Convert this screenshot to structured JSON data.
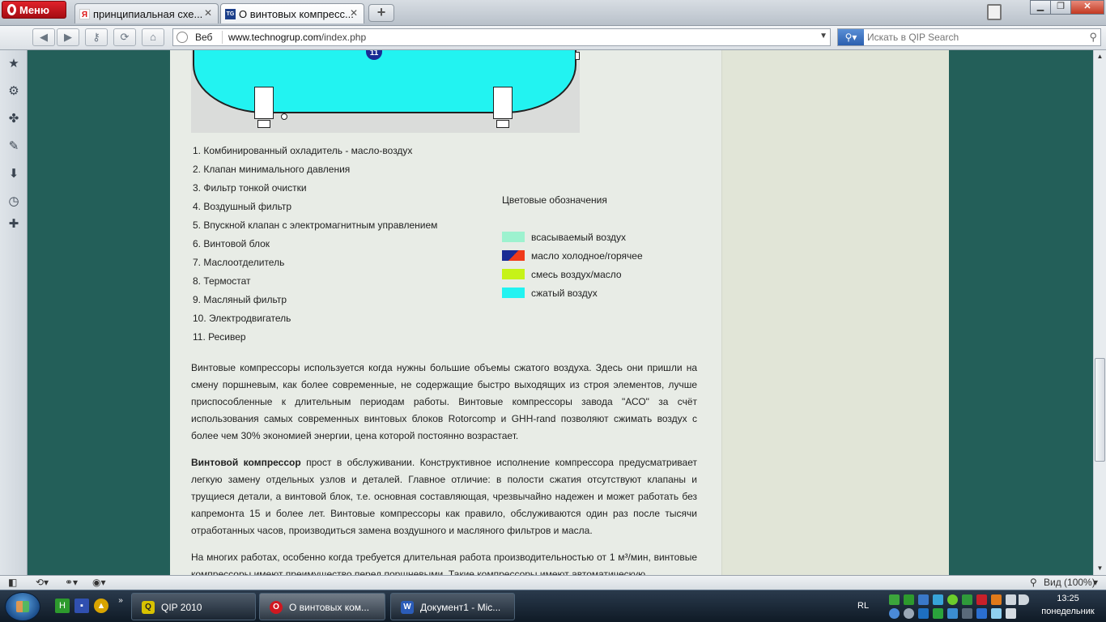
{
  "browser": {
    "menu_label": "Меню",
    "tabs": [
      {
        "label": "принципиальная схе...",
        "favicon": "Я",
        "active": false
      },
      {
        "label": "О винтовых компресс...",
        "favicon": "TG",
        "active": true
      }
    ],
    "new_tab_label": "+",
    "address": {
      "mode_label": "Веб",
      "domain": "www.technogrup.com",
      "path": "/index.php"
    },
    "search_placeholder": "Искать в QIP Search",
    "zoom_label": "Вид (100%)"
  },
  "page": {
    "parts_list": [
      "1. Комбинированный охладитель - масло-воздух",
      "2. Клапан минимального давления",
      "3. Фильтр тонкой очистки",
      "4. Воздушный фильтр",
      "5. Впускной клапан с электромагнитным управлением",
      "6. Винтовой блок",
      "7. Маслоотделитель",
      "8. Термостат",
      "9. Масляный фильтр",
      "10. Электродвигатель",
      "11. Ресивер"
    ],
    "diagram_marker": "11",
    "legend": {
      "title": "Цветовые обозначения",
      "items": [
        {
          "label": "всасываемый воздух",
          "color": "#9df2cf"
        },
        {
          "label": "масло холодное/горячее",
          "color": "#1a2b94",
          "color2": "#f03a1a"
        },
        {
          "label": "смесь воздух/масло",
          "color": "#c6f318"
        },
        {
          "label": "сжатый воздух",
          "color": "#22f3f1"
        }
      ]
    },
    "paragraph1": "Винтовые компрессоры используется когда нужны большие объемы сжатого воздуха. Здесь они пришли на смену поршневым, как более современные, не содержащие быстро выходящих из строя элементов, лучше приспособленные к длительным периодам работы. Винтовые компрессоры завода \"АСО\" за счёт использования самых современных винтовых блоков Rotorcomp и GHH-rand позволяют сжимать воздух с более чем 30% экономией энергии, цена которой постоянно возрастает.",
    "paragraph2_bold": "Винтовой компрессор",
    "paragraph2_rest": " прост в обслуживании. Конструктивное исполнение компрессора предусматривает легкую замену отдельных узлов и деталей. Главное отличие: в полости сжатия отсутствуют клапаны и трущиеся детали, а винтовой блок, т.е. основная составляющая, чрезвычайно надежен и может работать без капремонта 15 и более лет. Винтовые компрессоры как правило, обслуживаются один раз после тысячи отработанных часов, производиться замена воздушного и масляного фильтров и масла.",
    "paragraph3": "На многих работах, особенно когда требуется длительная работа производительностью от 1 м³/мин, винтовые компрессоры имеют преимущество перед поршневыми. Такие компрессоры имеют автоматическую"
  },
  "taskbar": {
    "tasks": [
      {
        "label": "QIP 2010",
        "icon": "qip-icon"
      },
      {
        "label": "О винтовых ком...",
        "icon": "opera-icon"
      },
      {
        "label": "Документ1 - Mic...",
        "icon": "word-icon"
      }
    ],
    "language": "RL",
    "time": "13:25",
    "day": "понедельник"
  }
}
